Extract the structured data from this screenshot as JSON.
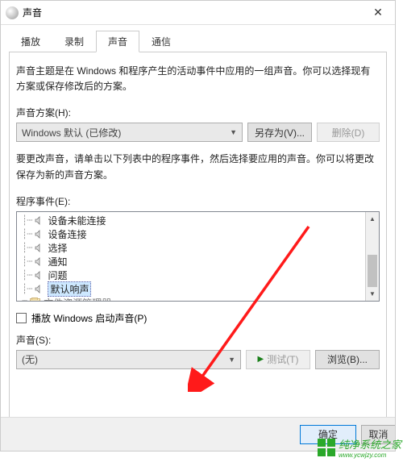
{
  "window": {
    "title": "声音"
  },
  "tabs": {
    "t0": "播放",
    "t1": "录制",
    "t2": "声音",
    "t3": "通信"
  },
  "section1": {
    "desc": "声音主题是在 Windows 和程序产生的活动事件中应用的一组声音。你可以选择现有方案或保存修改后的方案。",
    "scheme_label": "声音方案(H):",
    "scheme_value": "Windows 默认 (已修改)",
    "save_as": "另存为(V)...",
    "delete": "删除(D)"
  },
  "section2": {
    "desc": "要更改声音，请单击以下列表中的程序事件，然后选择要应用的声音。你可以将更改保存为新的声音方案。",
    "events_label": "程序事件(E):",
    "items": {
      "i0": "设备未能连接",
      "i1": "设备连接",
      "i2": "选择",
      "i3": "通知",
      "i4": "问题",
      "i5": "默认响声",
      "i6": "文件资源管理器"
    }
  },
  "startup": {
    "label": "播放 Windows 启动声音(P)"
  },
  "sound": {
    "label": "声音(S):",
    "value": "(无)",
    "test": "测试(T)",
    "browse": "浏览(B)..."
  },
  "buttons": {
    "ok": "确定",
    "cancel": "取消"
  },
  "watermark": {
    "text": "纯净系统之家",
    "url": "www.ycwjzy.com"
  }
}
